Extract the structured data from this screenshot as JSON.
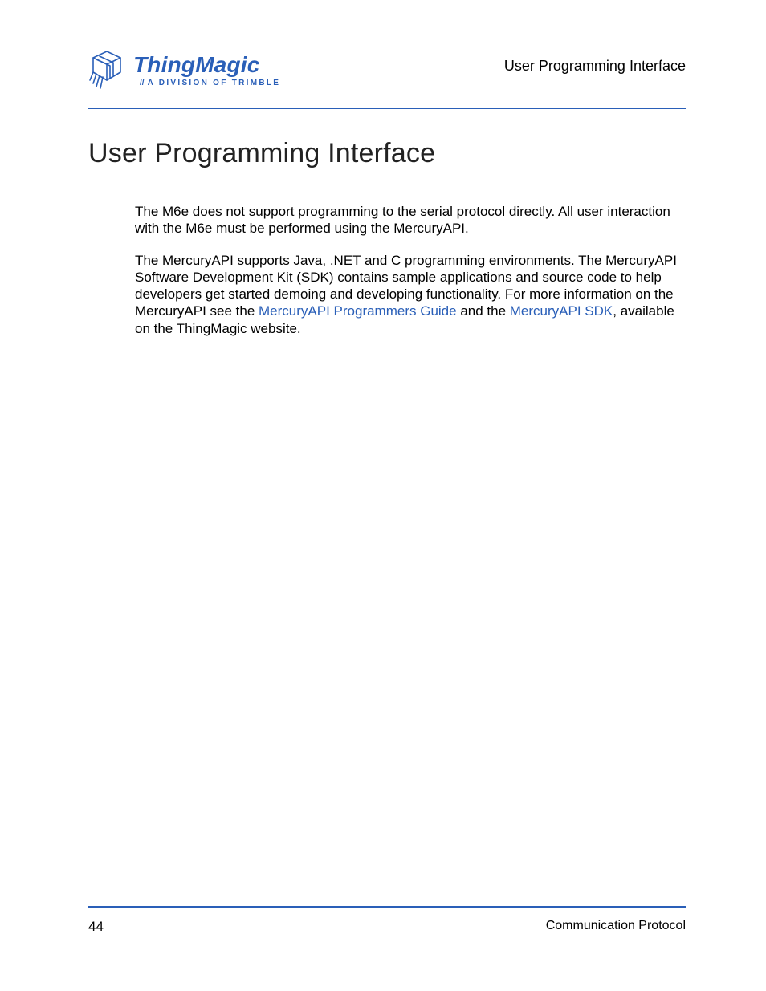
{
  "header": {
    "brand": "ThingMagic",
    "tagline_slashes": "//",
    "tagline": "A DIVISION OF TRIMBLE",
    "section_title": "User Programming Interface"
  },
  "main": {
    "heading": "User Programming Interface",
    "para1": "The M6e does not support programming to the serial protocol directly. All user interaction with the M6e must be performed using the MercuryAPI.",
    "para2_a": "The MercuryAPI supports Java, .NET and C programming environments. The MercuryAPI Software Development Kit (SDK) contains sample applications and source code to help developers get started demoing and developing functionality. For more information on the MercuryAPI see the ",
    "para2_link1": "MercuryAPI Programmers Guide",
    "para2_b": " and the ",
    "para2_link2": "MercuryAPI SDK",
    "para2_c": ", available on the ThingMagic website."
  },
  "footer": {
    "page_number": "44",
    "title": "Communication Protocol"
  }
}
